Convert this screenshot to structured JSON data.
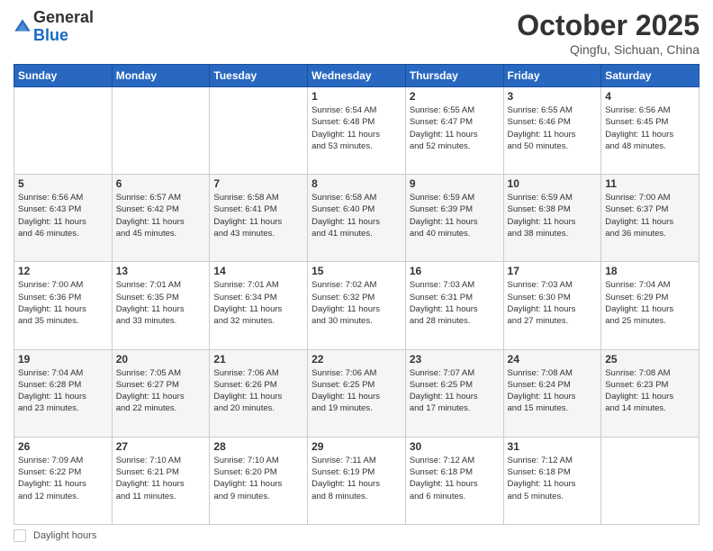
{
  "header": {
    "logo_general": "General",
    "logo_blue": "Blue",
    "month": "October 2025",
    "location": "Qingfu, Sichuan, China"
  },
  "weekdays": [
    "Sunday",
    "Monday",
    "Tuesday",
    "Wednesday",
    "Thursday",
    "Friday",
    "Saturday"
  ],
  "legend": {
    "label": "Daylight hours"
  },
  "weeks": [
    [
      {
        "day": "",
        "info": ""
      },
      {
        "day": "",
        "info": ""
      },
      {
        "day": "",
        "info": ""
      },
      {
        "day": "1",
        "info": "Sunrise: 6:54 AM\nSunset: 6:48 PM\nDaylight: 11 hours\nand 53 minutes."
      },
      {
        "day": "2",
        "info": "Sunrise: 6:55 AM\nSunset: 6:47 PM\nDaylight: 11 hours\nand 52 minutes."
      },
      {
        "day": "3",
        "info": "Sunrise: 6:55 AM\nSunset: 6:46 PM\nDaylight: 11 hours\nand 50 minutes."
      },
      {
        "day": "4",
        "info": "Sunrise: 6:56 AM\nSunset: 6:45 PM\nDaylight: 11 hours\nand 48 minutes."
      }
    ],
    [
      {
        "day": "5",
        "info": "Sunrise: 6:56 AM\nSunset: 6:43 PM\nDaylight: 11 hours\nand 46 minutes."
      },
      {
        "day": "6",
        "info": "Sunrise: 6:57 AM\nSunset: 6:42 PM\nDaylight: 11 hours\nand 45 minutes."
      },
      {
        "day": "7",
        "info": "Sunrise: 6:58 AM\nSunset: 6:41 PM\nDaylight: 11 hours\nand 43 minutes."
      },
      {
        "day": "8",
        "info": "Sunrise: 6:58 AM\nSunset: 6:40 PM\nDaylight: 11 hours\nand 41 minutes."
      },
      {
        "day": "9",
        "info": "Sunrise: 6:59 AM\nSunset: 6:39 PM\nDaylight: 11 hours\nand 40 minutes."
      },
      {
        "day": "10",
        "info": "Sunrise: 6:59 AM\nSunset: 6:38 PM\nDaylight: 11 hours\nand 38 minutes."
      },
      {
        "day": "11",
        "info": "Sunrise: 7:00 AM\nSunset: 6:37 PM\nDaylight: 11 hours\nand 36 minutes."
      }
    ],
    [
      {
        "day": "12",
        "info": "Sunrise: 7:00 AM\nSunset: 6:36 PM\nDaylight: 11 hours\nand 35 minutes."
      },
      {
        "day": "13",
        "info": "Sunrise: 7:01 AM\nSunset: 6:35 PM\nDaylight: 11 hours\nand 33 minutes."
      },
      {
        "day": "14",
        "info": "Sunrise: 7:01 AM\nSunset: 6:34 PM\nDaylight: 11 hours\nand 32 minutes."
      },
      {
        "day": "15",
        "info": "Sunrise: 7:02 AM\nSunset: 6:32 PM\nDaylight: 11 hours\nand 30 minutes."
      },
      {
        "day": "16",
        "info": "Sunrise: 7:03 AM\nSunset: 6:31 PM\nDaylight: 11 hours\nand 28 minutes."
      },
      {
        "day": "17",
        "info": "Sunrise: 7:03 AM\nSunset: 6:30 PM\nDaylight: 11 hours\nand 27 minutes."
      },
      {
        "day": "18",
        "info": "Sunrise: 7:04 AM\nSunset: 6:29 PM\nDaylight: 11 hours\nand 25 minutes."
      }
    ],
    [
      {
        "day": "19",
        "info": "Sunrise: 7:04 AM\nSunset: 6:28 PM\nDaylight: 11 hours\nand 23 minutes."
      },
      {
        "day": "20",
        "info": "Sunrise: 7:05 AM\nSunset: 6:27 PM\nDaylight: 11 hours\nand 22 minutes."
      },
      {
        "day": "21",
        "info": "Sunrise: 7:06 AM\nSunset: 6:26 PM\nDaylight: 11 hours\nand 20 minutes."
      },
      {
        "day": "22",
        "info": "Sunrise: 7:06 AM\nSunset: 6:25 PM\nDaylight: 11 hours\nand 19 minutes."
      },
      {
        "day": "23",
        "info": "Sunrise: 7:07 AM\nSunset: 6:25 PM\nDaylight: 11 hours\nand 17 minutes."
      },
      {
        "day": "24",
        "info": "Sunrise: 7:08 AM\nSunset: 6:24 PM\nDaylight: 11 hours\nand 15 minutes."
      },
      {
        "day": "25",
        "info": "Sunrise: 7:08 AM\nSunset: 6:23 PM\nDaylight: 11 hours\nand 14 minutes."
      }
    ],
    [
      {
        "day": "26",
        "info": "Sunrise: 7:09 AM\nSunset: 6:22 PM\nDaylight: 11 hours\nand 12 minutes."
      },
      {
        "day": "27",
        "info": "Sunrise: 7:10 AM\nSunset: 6:21 PM\nDaylight: 11 hours\nand 11 minutes."
      },
      {
        "day": "28",
        "info": "Sunrise: 7:10 AM\nSunset: 6:20 PM\nDaylight: 11 hours\nand 9 minutes."
      },
      {
        "day": "29",
        "info": "Sunrise: 7:11 AM\nSunset: 6:19 PM\nDaylight: 11 hours\nand 8 minutes."
      },
      {
        "day": "30",
        "info": "Sunrise: 7:12 AM\nSunset: 6:18 PM\nDaylight: 11 hours\nand 6 minutes."
      },
      {
        "day": "31",
        "info": "Sunrise: 7:12 AM\nSunset: 6:18 PM\nDaylight: 11 hours\nand 5 minutes."
      },
      {
        "day": "",
        "info": ""
      }
    ]
  ]
}
